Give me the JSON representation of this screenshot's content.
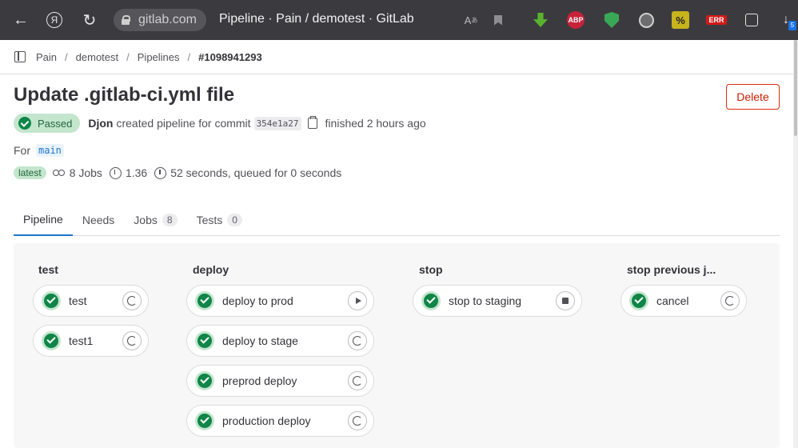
{
  "browser": {
    "back_icon": "back-arrow-icon",
    "domain": "gitlab.com",
    "tab_title": "Pipeline · Pain / demotest · GitLab",
    "ext_abp_label": "ABP",
    "ext_err_label": "ERR",
    "download_count": "5"
  },
  "breadcrumb": {
    "items": [
      "Pain",
      "demotest",
      "Pipelines"
    ],
    "current": "#1098941293"
  },
  "header": {
    "title": "Update .gitlab-ci.yml file",
    "delete_label": "Delete",
    "status": "Passed",
    "user": "Djon",
    "created_text": "created pipeline for commit",
    "commit_sha": "354e1a27",
    "finished_text": "finished 2 hours ago",
    "for_label": "For",
    "branch": "main",
    "latest_badge": "latest",
    "jobs_text": "8 Jobs",
    "score": "1.36",
    "duration_text": "52 seconds, queued for 0 seconds"
  },
  "tabs": [
    {
      "label": "Pipeline",
      "count": null,
      "active": true
    },
    {
      "label": "Needs",
      "count": null,
      "active": false
    },
    {
      "label": "Jobs",
      "count": "8",
      "active": false
    },
    {
      "label": "Tests",
      "count": "0",
      "active": false
    }
  ],
  "stages": [
    {
      "title": "test",
      "jobs": [
        {
          "name": "test",
          "action": "retry"
        },
        {
          "name": "test1",
          "action": "retry"
        }
      ]
    },
    {
      "title": "deploy",
      "jobs": [
        {
          "name": "deploy to prod",
          "action": "play"
        },
        {
          "name": "deploy to stage",
          "action": "retry"
        },
        {
          "name": "preprod deploy",
          "action": "retry"
        },
        {
          "name": "production deploy",
          "action": "retry"
        }
      ]
    },
    {
      "title": "stop",
      "jobs": [
        {
          "name": "stop to staging",
          "action": "stop"
        }
      ]
    },
    {
      "title": "stop previous j...",
      "jobs": [
        {
          "name": "cancel",
          "action": "retry"
        }
      ]
    }
  ],
  "colors": {
    "success": "#108548",
    "danger": "#dd2b0e",
    "link": "#1f75cb"
  }
}
